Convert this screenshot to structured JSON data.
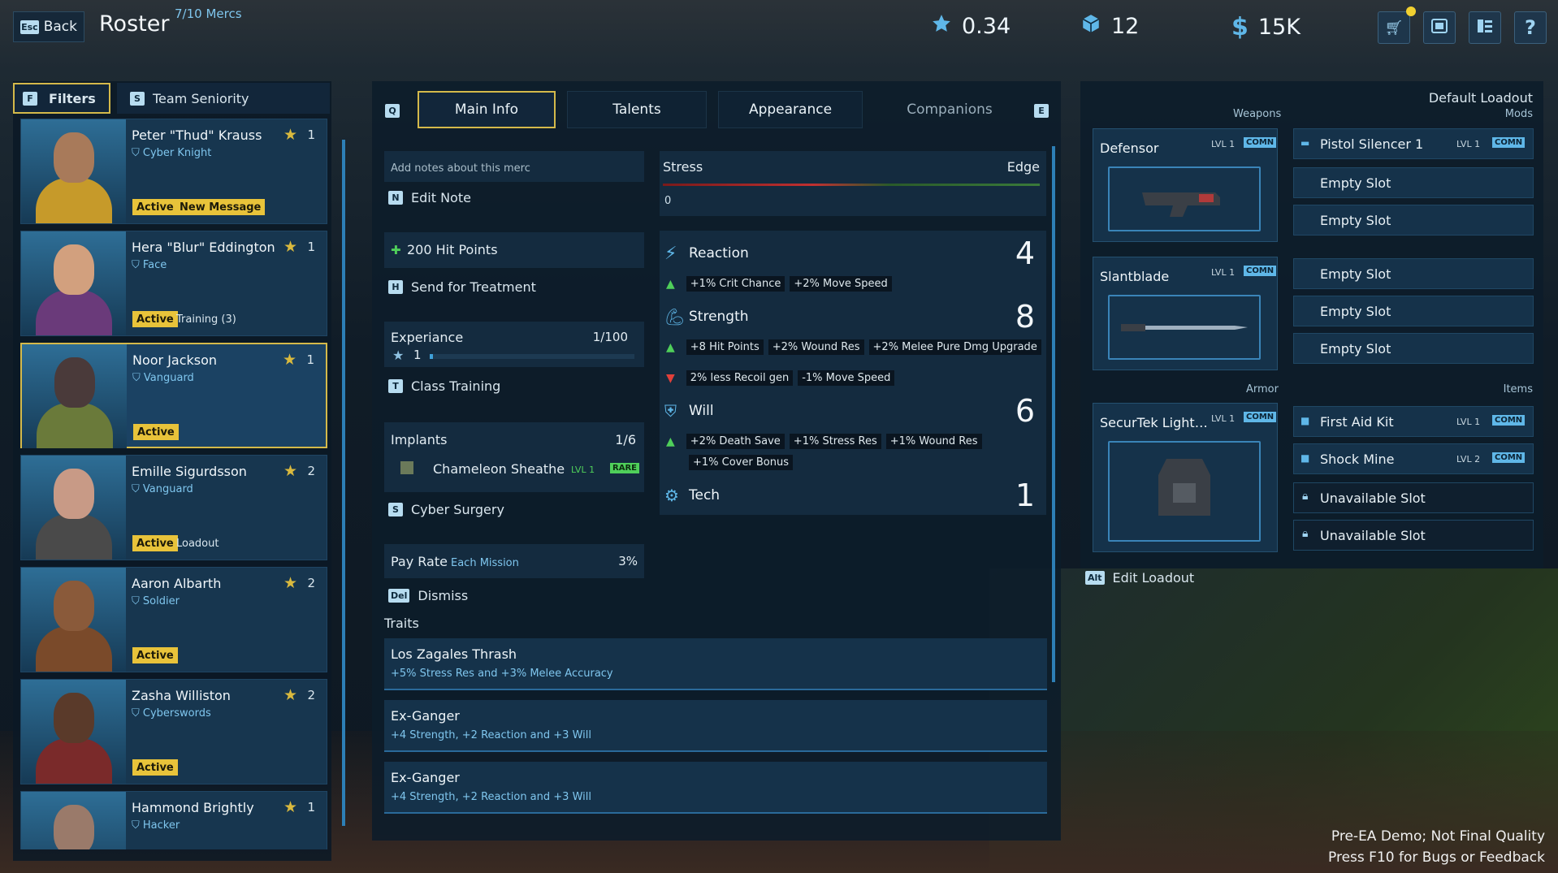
{
  "topbar": {
    "back_key": "Esc",
    "back_label": "Back",
    "title": "Roster",
    "merc_count": "7/10 Mercs",
    "stat_rep": "0.34",
    "stat_parts": "12",
    "stat_money": "15K"
  },
  "filters": {
    "key": "F",
    "label": "Filters",
    "sort_key": "S",
    "sort_label": "Team Seniority"
  },
  "roster": [
    {
      "name": "Peter \"Thud\" Krauss",
      "role": "Cyber Knight",
      "rank": "1",
      "badge1": "Active",
      "badge2": "New Message",
      "badge2_style": "yellow",
      "skin": "#a87a5a",
      "suit": "#c69a2a"
    },
    {
      "name": "Hera \"Blur\" Eddington",
      "role": "Face",
      "rank": "1",
      "badge1": "Active",
      "badge2": "Training (3)",
      "badge2_style": "plain",
      "skin": "#d2a07e",
      "suit": "#6a3a7a"
    },
    {
      "name": "Noor Jackson",
      "role": "Vanguard",
      "rank": "1",
      "badge1": "Active",
      "badge2": "",
      "badge2_style": "plain",
      "skin": "#4a3a3a",
      "suit": "#6a7a3a"
    },
    {
      "name": "Emille Sigurdsson",
      "role": "Vanguard",
      "rank": "2",
      "badge1": "Active",
      "badge2": "Loadout",
      "badge2_style": "plain",
      "skin": "#c89a86",
      "suit": "#4a4a4a"
    },
    {
      "name": "Aaron Albarth",
      "role": "Soldier",
      "rank": "2",
      "badge1": "Active",
      "badge2": "",
      "badge2_style": "plain",
      "skin": "#8a5a3a",
      "suit": "#7a4a2a"
    },
    {
      "name": "Zasha Williston",
      "role": "Cyberswords",
      "rank": "2",
      "badge1": "Active",
      "badge2": "",
      "badge2_style": "plain",
      "skin": "#5a3a2a",
      "suit": "#7a2a2a"
    },
    {
      "name": "Hammond Brightly",
      "role": "Hacker",
      "rank": "1",
      "badge1": "",
      "badge2": "",
      "badge2_style": "plain",
      "skin": "#9a7a6a",
      "suit": "#3a3a3a"
    }
  ],
  "tabs": {
    "q_key": "Q",
    "e_key": "E",
    "main": "Main Info",
    "talents": "Talents",
    "appearance": "Appearance",
    "companions": "Companions"
  },
  "notes": {
    "placeholder": "Add notes about this merc",
    "edit_key": "N",
    "edit_label": "Edit Note"
  },
  "health": {
    "label": "200 Hit Points",
    "treat_key": "H",
    "treat_label": "Send for Treatment"
  },
  "experience": {
    "label": "Experiance",
    "value": "1/100",
    "level": "1",
    "progress": 0.01,
    "train_key": "T",
    "train_label": "Class Training"
  },
  "implants": {
    "label": "Implants",
    "count": "1/6",
    "item": "Chameleon Sheathe",
    "item_lvl": "LVL 1",
    "item_rarity": "RARE",
    "surgery_key": "S",
    "surgery_label": "Cyber Surgery"
  },
  "pay": {
    "label": "Pay Rate",
    "sub": "Each Mission",
    "value": "3%",
    "dismiss_key": "Del",
    "dismiss_label": "Dismiss"
  },
  "stress": {
    "label": "Stress",
    "edge": "Edge",
    "value": "0"
  },
  "attributes": {
    "reaction": {
      "name": "Reaction",
      "value": "4",
      "up": [
        "+1% Crit Chance",
        "+2% Move Speed"
      ]
    },
    "strength": {
      "name": "Strength",
      "value": "8",
      "up": [
        "+8 Hit Points",
        "+2% Wound Res",
        "+2% Melee Pure Dmg Upgrade"
      ],
      "down": [
        "2% less Recoil gen",
        "-1% Move Speed"
      ]
    },
    "will": {
      "name": "Will",
      "value": "6",
      "up": [
        "+2% Death Save",
        "+1% Stress Res",
        "+1% Wound Res",
        "+1% Cover Bonus"
      ]
    },
    "tech": {
      "name": "Tech",
      "value": "1"
    }
  },
  "traits": {
    "label": "Traits",
    "items": [
      {
        "name": "Los Zagales Thrash",
        "desc": "+5% Stress Res and +3% Melee Accuracy"
      },
      {
        "name": "Ex-Ganger",
        "desc": "+4 Strength, +2 Reaction and +3 Will"
      },
      {
        "name": "Ex-Ganger",
        "desc": "+4 Strength, +2 Reaction and +3 Will"
      }
    ]
  },
  "loadout": {
    "title": "Default Loadout",
    "weapons_label": "Weapons",
    "mods_label": "Mods",
    "armor_label": "Armor",
    "items_label": "Items",
    "weapons": [
      {
        "name": "Defensor",
        "lvl": "LVL 1",
        "rarity": "COMN"
      },
      {
        "name": "Slantblade",
        "lvl": "LVL 1",
        "rarity": "COMN"
      }
    ],
    "armor": {
      "name": "SecurTek Light…",
      "lvl": "LVL 1",
      "rarity": "COMN"
    },
    "mods": [
      {
        "name": "Pistol Silencer 1",
        "lvl": "LVL 1",
        "rarity": "COMN"
      },
      {
        "name": "Empty Slot"
      },
      {
        "name": "Empty Slot"
      },
      {
        "name": "Empty Slot"
      },
      {
        "name": "Empty Slot"
      },
      {
        "name": "Empty Slot"
      }
    ],
    "items": [
      {
        "name": "First Aid Kit",
        "lvl": "LVL 1",
        "rarity": "COMN"
      },
      {
        "name": "Shock Mine",
        "lvl": "LVL 2",
        "rarity": "COMN"
      },
      {
        "name": "Unavailable Slot"
      },
      {
        "name": "Unavailable Slot"
      }
    ],
    "edit_key": "Alt",
    "edit_label": "Edit Loadout"
  },
  "footer": {
    "line1": "Pre-EA Demo; Not Final Quality",
    "line2": "Press F10 for Bugs or Feedback"
  },
  "colors": {
    "accent": "#d4b94a",
    "active_badge": "#e8c33a",
    "blue": "#5fb7e8",
    "up": "#4fcf5a",
    "down": "#e0403a"
  }
}
